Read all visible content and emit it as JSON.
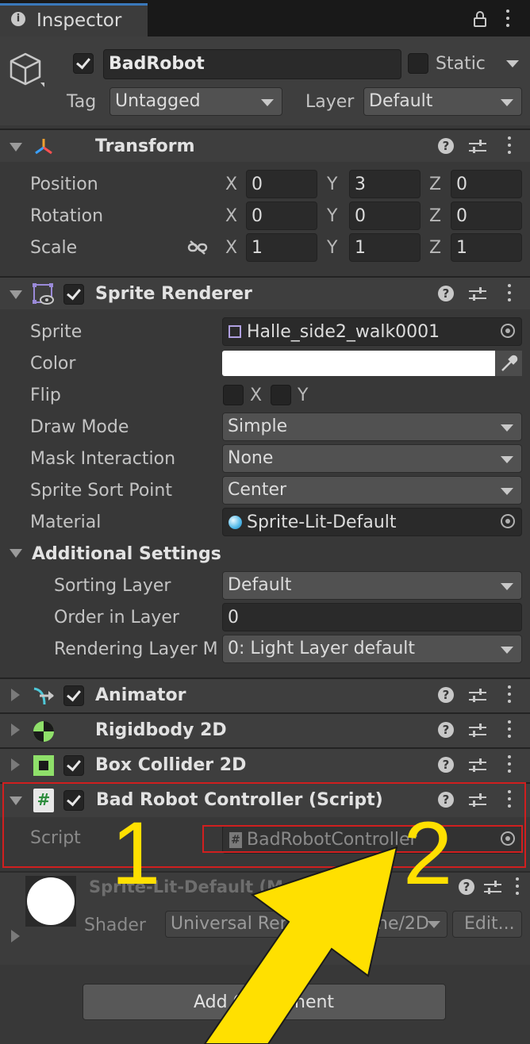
{
  "tab": {
    "title": "Inspector",
    "info_icon": "info-icon",
    "lock_icon": "lock-icon"
  },
  "gameobject": {
    "active": true,
    "name": "BadRobot",
    "static_label": "Static",
    "tag_label": "Tag",
    "tag_value": "Untagged",
    "layer_label": "Layer",
    "layer_value": "Default"
  },
  "transform": {
    "title": "Transform",
    "rows": [
      {
        "label": "Position",
        "x": "0",
        "y": "3",
        "z": "0"
      },
      {
        "label": "Rotation",
        "x": "0",
        "y": "0",
        "z": "0"
      },
      {
        "label": "Scale",
        "x": "1",
        "y": "1",
        "z": "1"
      }
    ],
    "axis": {
      "x": "X",
      "y": "Y",
      "z": "Z"
    }
  },
  "sprite_renderer": {
    "title": "Sprite Renderer",
    "sprite_label": "Sprite",
    "sprite_value": "Halle_side2_walk0001",
    "color_label": "Color",
    "color_value": "#ffffff",
    "flip_label": "Flip",
    "flip_x": "X",
    "flip_y": "Y",
    "draw_mode_label": "Draw Mode",
    "draw_mode_value": "Simple",
    "mask_label": "Mask Interaction",
    "mask_value": "None",
    "sort_point_label": "Sprite Sort Point",
    "sort_point_value": "Center",
    "material_label": "Material",
    "material_value": "Sprite-Lit-Default",
    "additional_title": "Additional Settings",
    "sorting_layer_label": "Sorting Layer",
    "sorting_layer_value": "Default",
    "order_label": "Order in Layer",
    "order_value": "0",
    "rendering_label": "Rendering Layer M",
    "rendering_value": "0: Light Layer default"
  },
  "components": [
    {
      "title": "Animator"
    },
    {
      "title": "Rigidbody 2D"
    },
    {
      "title": "Box Collider 2D"
    },
    {
      "title": "Bad Robot Controller (Script)"
    }
  ],
  "script": {
    "label": "Script",
    "value": "BadRobotController"
  },
  "material": {
    "name": "Sprite-Lit-Default (Mate",
    "shader_label": "Shader",
    "shader_value": "Universal Ren",
    "shader_value_tail": "ne/2D",
    "edit_label": "Edit..."
  },
  "add_component": {
    "label": "Add C",
    "label_tail": "nent"
  },
  "annotations": {
    "one": "1",
    "two": "2"
  },
  "colors": {
    "highlight": "#d01f1f",
    "arrow": "#ffe000",
    "accent": "#3a79bb"
  }
}
